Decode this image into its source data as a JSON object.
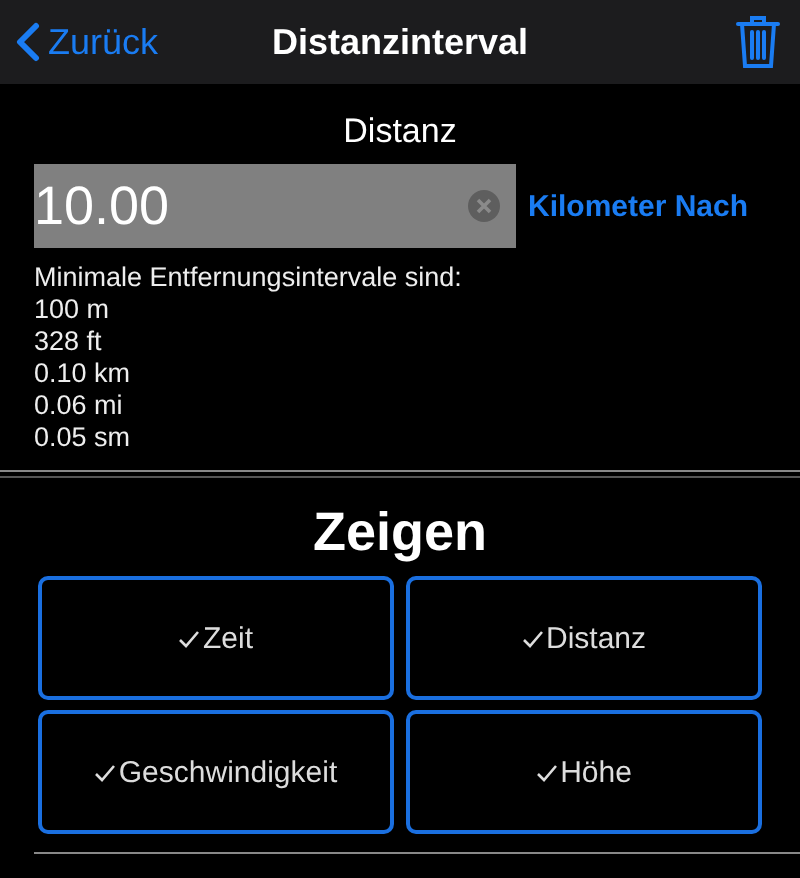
{
  "nav": {
    "back": "Zurück",
    "title": "Distanzinterval"
  },
  "distance": {
    "label": "Distanz",
    "value": "10.00",
    "unit_button": "Kilometer Nach"
  },
  "info": [
    "Minimale Entfernungsintervale sind:",
    "100 m",
    "328 ft",
    "0.10 km",
    "0.06 mi",
    "0.05 sm"
  ],
  "show": {
    "title": "Zeigen",
    "options": [
      {
        "label": "Zeit",
        "checked": true
      },
      {
        "label": "Distanz",
        "checked": true
      },
      {
        "label": "Geschwindigkeit",
        "checked": true
      },
      {
        "label": "Höhe",
        "checked": true
      }
    ]
  }
}
